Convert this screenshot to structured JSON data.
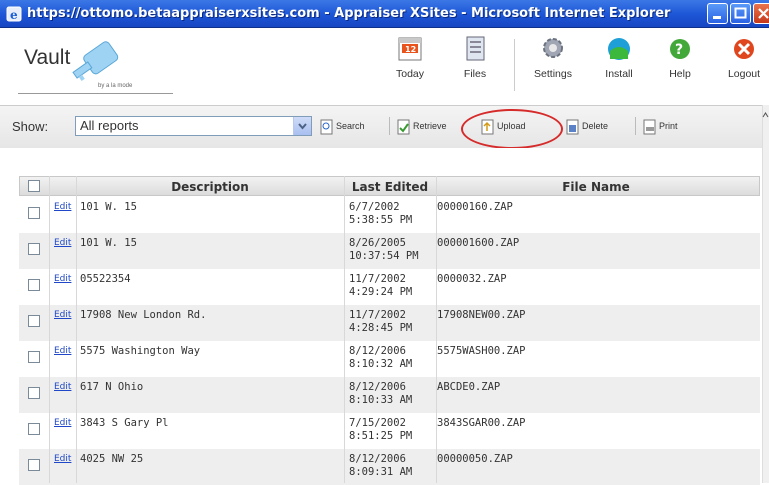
{
  "window": {
    "title": "https://ottomo.betaappraiserxsites.com - Appraiser XSites - Microsoft Internet Explorer"
  },
  "logo": {
    "name": "Vault",
    "tagline": "by a la mode"
  },
  "topnav": [
    {
      "label": "Today",
      "icon": "calendar-icon",
      "date": "12"
    },
    {
      "label": "Files",
      "icon": "files-icon"
    },
    {
      "label": "Settings",
      "icon": "settings-icon"
    },
    {
      "label": "Install",
      "icon": "install-icon"
    },
    {
      "label": "Help",
      "icon": "help-icon"
    },
    {
      "label": "Logout",
      "icon": "logout-icon"
    }
  ],
  "toolbar": {
    "show_label": "Show:",
    "show_value": "All reports",
    "buttons": [
      {
        "label": "Search",
        "icon": "search-icon"
      },
      {
        "label": "Retrieve",
        "icon": "retrieve-icon"
      },
      {
        "label": "Upload",
        "icon": "upload-icon"
      },
      {
        "label": "Delete",
        "icon": "delete-icon"
      },
      {
        "label": "Print",
        "icon": "print-icon"
      }
    ],
    "highlight_color": "#d62b2b"
  },
  "table": {
    "columns": [
      "Description",
      "Last Edited",
      "File Name"
    ],
    "edit_label": "Edit",
    "rows": [
      {
        "description": "101 W. 15",
        "date": "6/7/2002",
        "time": "5:38:55 PM",
        "file": "00000160.ZAP"
      },
      {
        "description": "101 W. 15",
        "date": "8/26/2005",
        "time": "10:37:54 PM",
        "file": "000001600.ZAP"
      },
      {
        "description": "05522354",
        "date": "11/7/2002",
        "time": "4:29:24 PM",
        "file": "0000032.ZAP"
      },
      {
        "description": "17908 New London Rd.",
        "date": "11/7/2002",
        "time": "4:28:45 PM",
        "file": "17908NEW00.ZAP"
      },
      {
        "description": "5575 Washington Way",
        "date": "8/12/2006",
        "time": "8:10:32 AM",
        "file": "5575WASH00.ZAP"
      },
      {
        "description": "617 N Ohio",
        "date": "8/12/2006",
        "time": "8:10:33 AM",
        "file": "ABCDE0.ZAP"
      },
      {
        "description": "3843 S Gary Pl",
        "date": "7/15/2002",
        "time": "8:51:25 PM",
        "file": "3843SGAR00.ZAP"
      },
      {
        "description": "4025 NW 25",
        "date": "8/12/2006",
        "time": "8:09:31 AM",
        "file": "00000050.ZAP"
      }
    ]
  }
}
